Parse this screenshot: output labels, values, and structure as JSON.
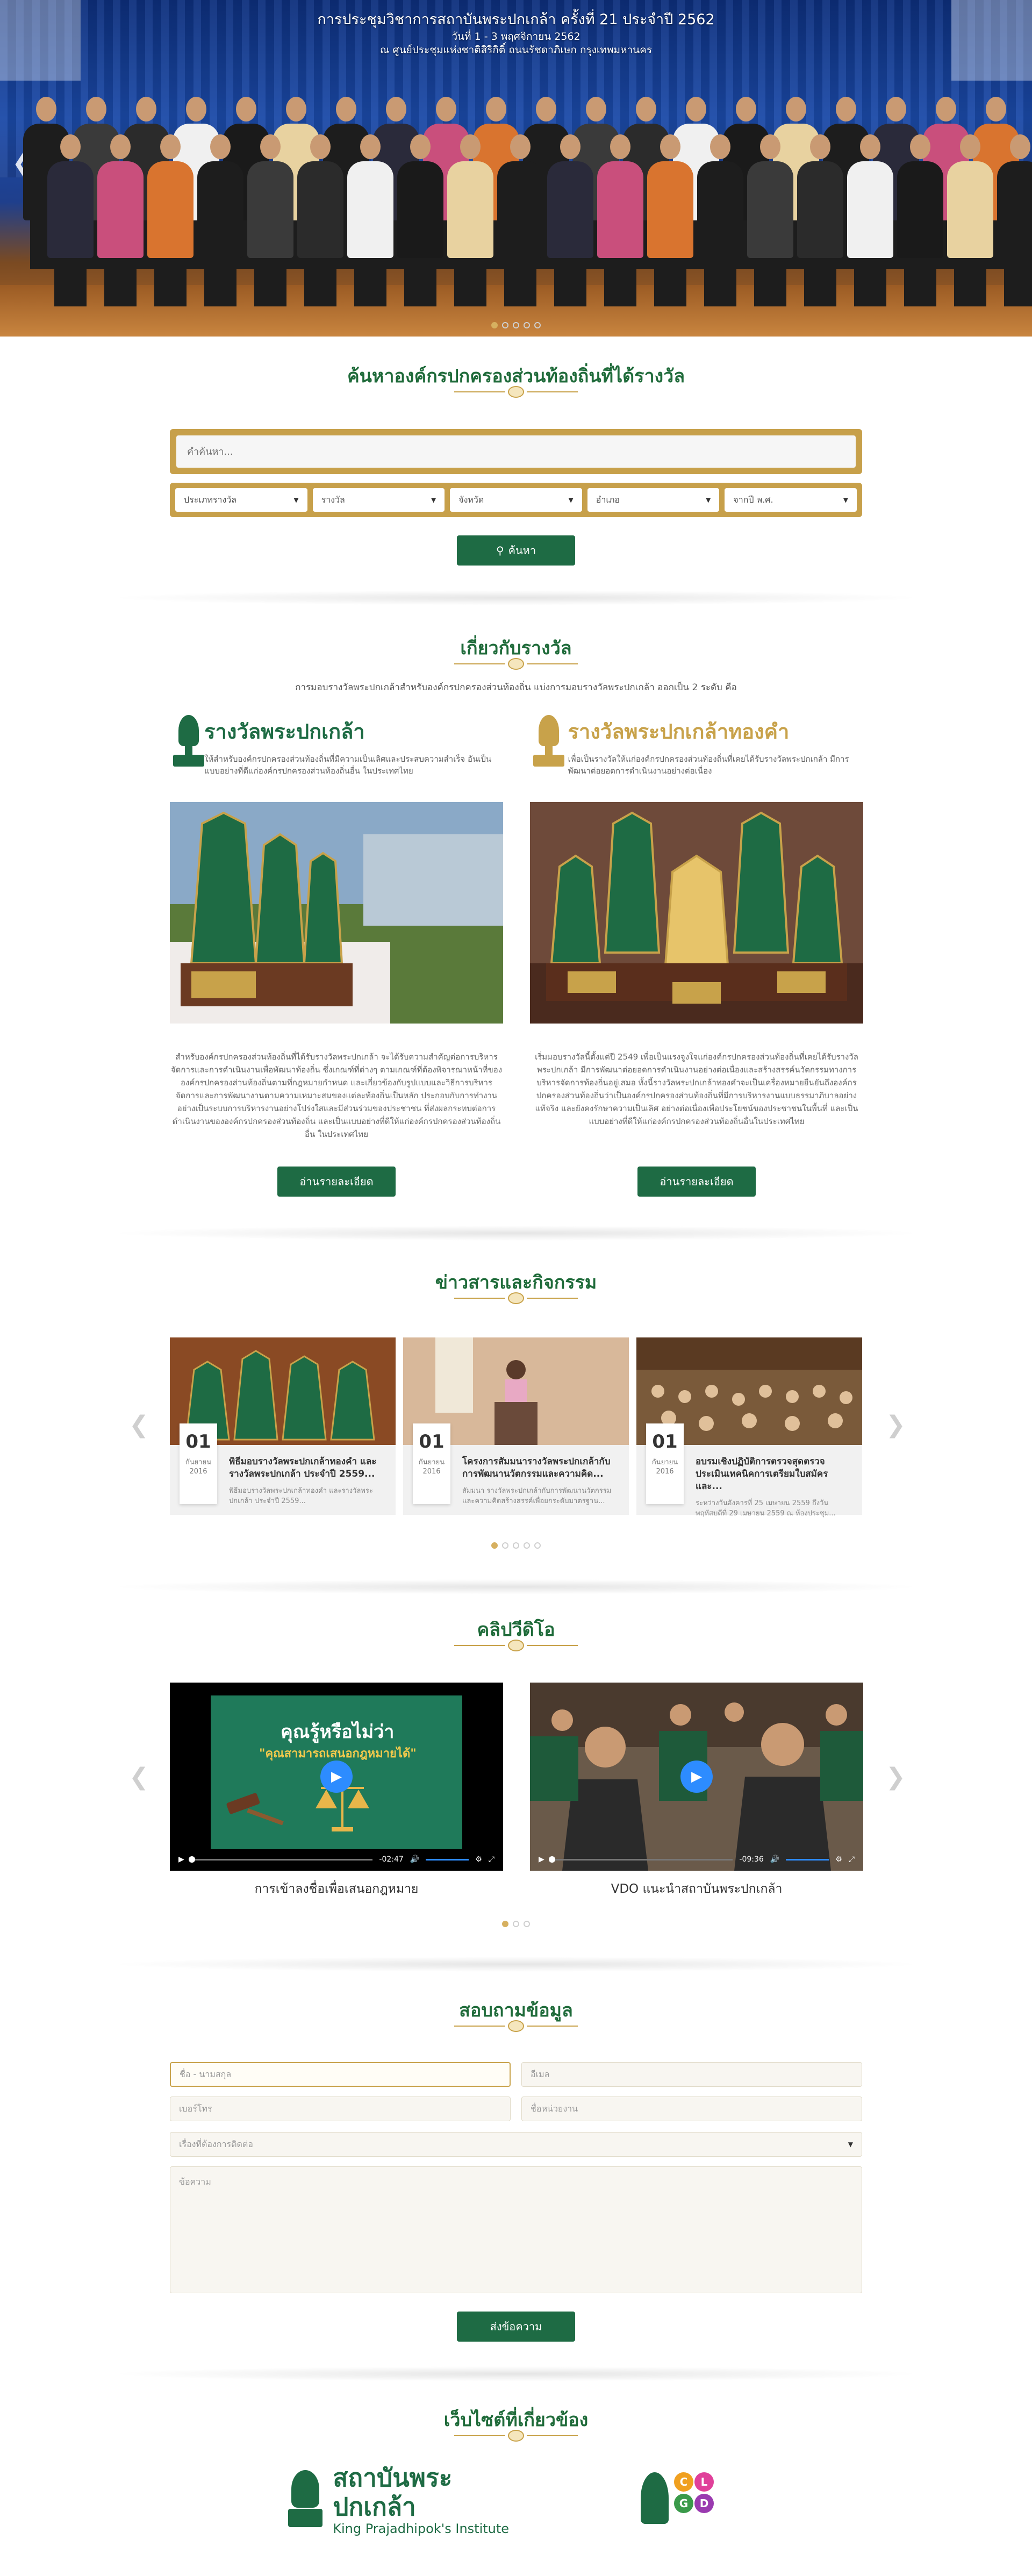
{
  "hero": {
    "title": "การประชุมวิชาการสถาบันพระปกเกล้า ครั้งที่ 21 ประจำปี 2562",
    "date_line": "วันที่ 1 - 3 พฤศจิกายน 2562",
    "venue_line": "ณ ศูนย์ประชุมแห่งชาติสิริกิติ์ ถนนรัชดาภิเษก กรุงเทพมหานคร",
    "slide_count": 5,
    "active_slide": 0
  },
  "search": {
    "heading": "ค้นหาองค์กรปกครองส่วนท้องถิ่นที่ได้รางวัล",
    "placeholder": "คำค้นหา...",
    "filters": [
      "ประเภทรางวัล",
      "รางวัล",
      "จังหวัด",
      "อำเภอ",
      "จากปี พ.ศ."
    ],
    "button_label": "ค้นหา"
  },
  "about": {
    "heading": "เกี่ยวกับรางวัล",
    "intro": "การมอบรางวัลพระปกเกล้าสำหรับองค์กรปกครองส่วนท้องถิ่น แบ่งการมอบรางวัลพระปกเกล้า ออกเป็น 2 ระดับ คือ",
    "awards": [
      {
        "name": "รางวัลพระปกเกล้า",
        "short": "ให้สำหรับองค์กรปกครองส่วนท้องถิ่นที่มีความเป็นเลิศและประสบความสำเร็จ อันเป็นแบบอย่างที่ดีแก่องค์กรปกครองส่วนท้องถิ่นอื่น ในประเทศไทย",
        "long": "สำหรับองค์กรปกครองส่วนท้องถิ่นที่ได้รับรางวัลพระปกเกล้า จะได้รับความสำคัญต่อการบริหารจัดการและการดำเนินงานเพื่อพัฒนาท้องถิ่น ซึ่งเกณฑ์ที่ต่างๆ ตามเกณฑ์ที่ต้องพิจารณาหน้าที่ขององค์กรปกครองส่วนท้องถิ่นตามที่กฎหมายกำหนด และเกี่ยวข้องกับรูปแบบและวิธีการบริหารจัดการและการพัฒนางานตามความเหมาะสมของแต่ละท้องถิ่นเป็นหลัก ประกอบกับการทำงานอย่างเป็นระบบการบริหารงานอย่างโปร่งใสและมีส่วนร่วมของประชาชน ที่ส่งผลกระทบต่อการดำเนินงานขององค์กรปกครองส่วนท้องถิ่น และเป็นแบบอย่างที่ดีให้แก่องค์กรปกครองส่วนท้องถิ่นอื่น ในประเทศไทย",
        "button_label": "อ่านรายละเอียด",
        "color": "#1e6b44"
      },
      {
        "name": "รางวัลพระปกเกล้าทองคำ",
        "short": "เพื่อเป็นรางวัลให้แก่องค์กรปกครองส่วนท้องถิ่นที่เคยได้รับรางวัลพระปกเกล้า มีการพัฒนาต่อยอดการดำเนินงานอย่างต่อเนื่อง",
        "long": "เริ่มมอบรางวัลนี้ตั้งแต่ปี 2549 เพื่อเป็นแรงจูงใจแก่องค์กรปกครองส่วนท้องถิ่นที่เคยได้รับรางวัลพระปกเกล้า มีการพัฒนาต่อยอดการดำเนินงานอย่างต่อเนื่องและสร้างสรรค์นวัตกรรมทางการบริหารจัดการท้องถิ่นอยู่เสมอ ทั้งนี้รางวัลพระปกเกล้าทองคำจะเป็นเครื่องหมายยืนยันถึงองค์กรปกครองส่วนท้องถิ่นว่าเป็นองค์กรปกครองส่วนท้องถิ่นที่มีการบริหารงานแบบธรรมาภิบาลอย่างแท้จริง และยังคงรักษาความเป็นเลิศ อย่างต่อเนื่องเพื่อประโยชน์ของประชาชนในพื้นที่ และเป็นแบบอย่างที่ดีให้แก่องค์กรปกครองส่วนท้องถิ่นอื่นในประเทศไทย",
        "button_label": "อ่านรายละเอียด",
        "color": "#c8a24a"
      }
    ]
  },
  "news": {
    "heading": "ข่าวสารและกิจกรรม",
    "items": [
      {
        "day": "01",
        "month": "กันยายน",
        "year": "2016",
        "title": "พิธีมอบรางวัลพระปกเกล้าทองคำ และรางวัลพระปกเกล้า ประจำปี 2559...",
        "excerpt": "พิธีมอบรางวัลพระปกเกล้าทองคำ และรางวัลพระปกเกล้า ประจำปี 2559..."
      },
      {
        "day": "01",
        "month": "กันยายน",
        "year": "2016",
        "title": "โครงการสัมมนารางวัลพระปกเกล้ากับการพัฒนานวัตกรรมและความคิด...",
        "excerpt": "สัมมนา รางวัลพระปกเกล้ากับการพัฒนานวัตกรรมและความคิดสร้างสรรค์เพื่อยกระดับมาตรฐาน..."
      },
      {
        "day": "01",
        "month": "กันยายน",
        "year": "2016",
        "title": "อบรมเชิงปฏิบัติการตรวจสุดตรวจประเมินเทคนิคการเตรียมใบสมัครและ...",
        "excerpt": "ระหว่างวันอังคารที่ 25 เมษายน 2559 ถึงวันพฤหัสบดีที่ 29 เมษายน 2559 ณ ห้องประชุม..."
      }
    ],
    "slide_count": 5,
    "active_slide": 0
  },
  "videos": {
    "heading": "คลิปวีดิโอ",
    "items": [
      {
        "caption": "การเข้าลงชื่อเพื่อเสนอกฎหมาย",
        "time": "-02:47",
        "overlay_title": "คุณรู้หรือไม่ว่า",
        "overlay_sub": "\"คุณสามารถเสนอกฎหมายได้\""
      },
      {
        "caption": "VDO แนะนำสถาบันพระปกเกล้า",
        "time": "-09:36"
      }
    ],
    "slide_count": 3,
    "active_slide": 0
  },
  "contact": {
    "heading": "สอบถามข้อมูล",
    "fields": {
      "name": "ชื่อ - นามสกุล",
      "email": "อีเมล",
      "phone": "เบอร์โทร",
      "org": "ชื่อหน่วยงาน",
      "topic": "เรื่องที่ต้องการติดต่อ",
      "message": "ข้อความ"
    },
    "submit_label": "ส่งข้อความ"
  },
  "related": {
    "heading": "เว็บไซต์ที่เกี่ยวข้อง",
    "kpi_th": "สถาบันพระปกเกล้า",
    "kpi_en": "King Prajadhipok's Institute",
    "clgd_letters": [
      "C",
      "L",
      "G",
      "D"
    ]
  },
  "colors": {
    "green": "#1e6b44",
    "gold": "#c8a24a"
  }
}
